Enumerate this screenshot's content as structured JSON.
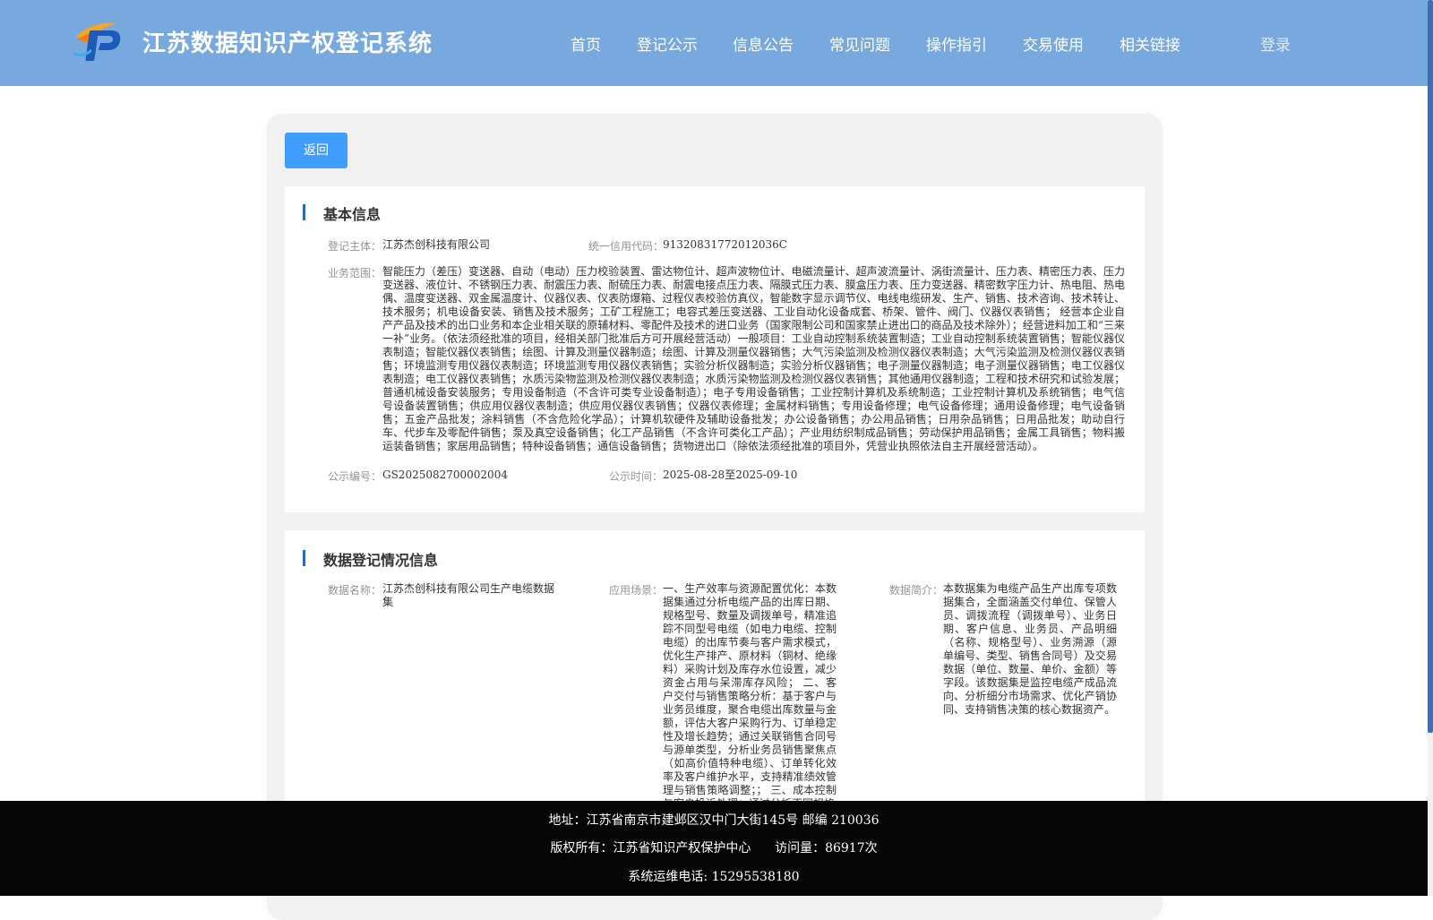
{
  "header": {
    "site_title": "江苏数据知识产权登记系统",
    "nav": [
      "首页",
      "登记公示",
      "信息公告",
      "常见问题",
      "操作指引",
      "交易使用",
      "相关链接"
    ],
    "login_label": "登录"
  },
  "actions": {
    "back_label": "返回"
  },
  "basic_info": {
    "title": "基本信息",
    "subject_label": "登记主体：",
    "subject_value": "江苏杰创科技有限公司",
    "credit_code_label": "统一信用代码：",
    "credit_code_value": "91320831772012036C",
    "scope_label": "业务范围：",
    "scope_value": "智能压力（差压）变送器、自动（电动）压力校验装置、雷达物位计、超声波物位计、电磁流量计、超声波流量计、涡街流量计、压力表、精密压力表、压力变送器、液位计、不锈钢压力表、耐震压力表、耐硫压力表、耐震电接点压力表、隔膜式压力表、膜盒压力表、压力变送器、精密数字压力计、热电阻、热电偶、温度变送器、双金属温度计、仪器仪表、仪表防爆箱、过程仪表校验仿真仪，智能数字显示调节仪、电线电缆研发、生产、销售、技术咨询、技术转让、技术服务；机电设备安装、销售及技术服务；工矿工程施工；电容式差压变送器、工业自动化设备成套、桥架、管件、阀门、仪器仪表销售； 经营本企业自产产品及技术的出口业务和本企业相关联的原辅材料、零配件及技术的进口业务（国家限制公司和国家禁止进出口的商品及技术除外）；经营进料加工和“三来一补”业务。（依法须经批准的项目，经相关部门批准后方可开展经营活动）一般项目：工业自动控制系统装置制造；工业自动控制系统装置销售；智能仪器仪表制造；智能仪器仪表销售；绘图、计算及测量仪器制造；绘图、计算及测量仪器销售；大气污染监测及检测仪器仪表制造；大气污染监测及检测仪器仪表销售；环境监测专用仪器仪表制造；环境监测专用仪器仪表销售；实验分析仪器制造；实验分析仪器销售；电子测量仪器制造；电子测量仪器销售；电工仪器仪表制造；电工仪器仪表销售；水质污染物监测及检测仪器仪表制造；水质污染物监测及检测仪器仪表销售；其他通用仪器制造；工程和技术研究和试验发展；普通机械设备安装服务；专用设备制造（不含许可类专业设备制造）；电子专用设备销售；工业控制计算机及系统制造；工业控制计算机及系统销售；电气信号设备装置销售；供应用仪器仪表制造；供应用仪器仪表销售；仪器仪表修理；金属材料销售；专用设备修理；电气设备修理；通用设备修理；电气设备销售；五金产品批发；涂料销售（不含危险化学品）；计算机软硬件及辅助设备批发；办公设备销售；办公用品销售；日用杂品销售；日用品批发；助动自行车、代步车及零配件销售；泵及真空设备销售；化工产品销售（不含许可类化工产品）；产业用纺织制成品销售；劳动保护用品销售；金属工具销售；物料搬运装备销售；家居用品销售；特种设备销售；通信设备销售；货物进出口（除依法须经批准的项目外，凭营业执照依法自主开展经营活动）。",
    "pub_no_label": "公示编号：",
    "pub_no_value": "GS2025082700002004",
    "pub_time_label": "公示时间：",
    "pub_time_value": "2025-08-28至2025-09-10"
  },
  "data_info": {
    "title": "数据登记情况信息",
    "name_label": "数据名称：",
    "name_value": "江苏杰创科技有限公司生产电缆数据集",
    "scene_label": "应用场景：",
    "scene_value": "一、生产效率与资源配置优化：本数据集通过分析电缆产品的出库日期、规格型号、数量及调拨单号，精准追踪不同型号电缆（如电力电缆、控制电缆）的出库节奏与客户需求模式，优化生产排产、原材料（铜材、绝缘料）采购计划及库存水位设置，减少资金占用与呆滞库存风险； 二、客户交付与销售策略分析：基于客户与业务员维度，聚合电缆出库数量与金额，评估大客户采购行为、订单稳定性及增长趋势；通过关联销售合同号与源单类型，分析业务员销售聚焦点（如高价值特种电缆）、订单转化效率及客户维护水平，支持精准绩效管理与销售策略调整；； 三、成本控制与客户投诉处理：通过分析不同规格",
    "intro_label": "数据简介：",
    "intro_value": "本数据集为电缆产品生产出库专项数据集合，全面涵盖交付单位、保管人员、调拨流程（调拨单号）、业务日期、客户信息、业务员、产品明细（名称、规格型号）、业务溯源（源单编号、类型、销售合同号）及交易数据（单位、数量、单价、金额）等字段。该数据集是监控电缆产成品流向、分析细分市场需求、优化产销协同、支持销售决策的核心数据资产。"
  },
  "footer": {
    "address": "地址：江苏省南京市建邺区汉中门大街145号 邮编 210036",
    "copyright": "版权所有：江苏省知识产权保护中心",
    "visits": "访问量：86917次",
    "phone": "系统运维电话: 15295538180"
  },
  "colors": {
    "header_bg": "#77a9df",
    "button": "#409eff",
    "accent_bar": "#2a68b8",
    "footer_bg": "#060606"
  },
  "icons": {
    "logo": "ip-logo-icon"
  }
}
